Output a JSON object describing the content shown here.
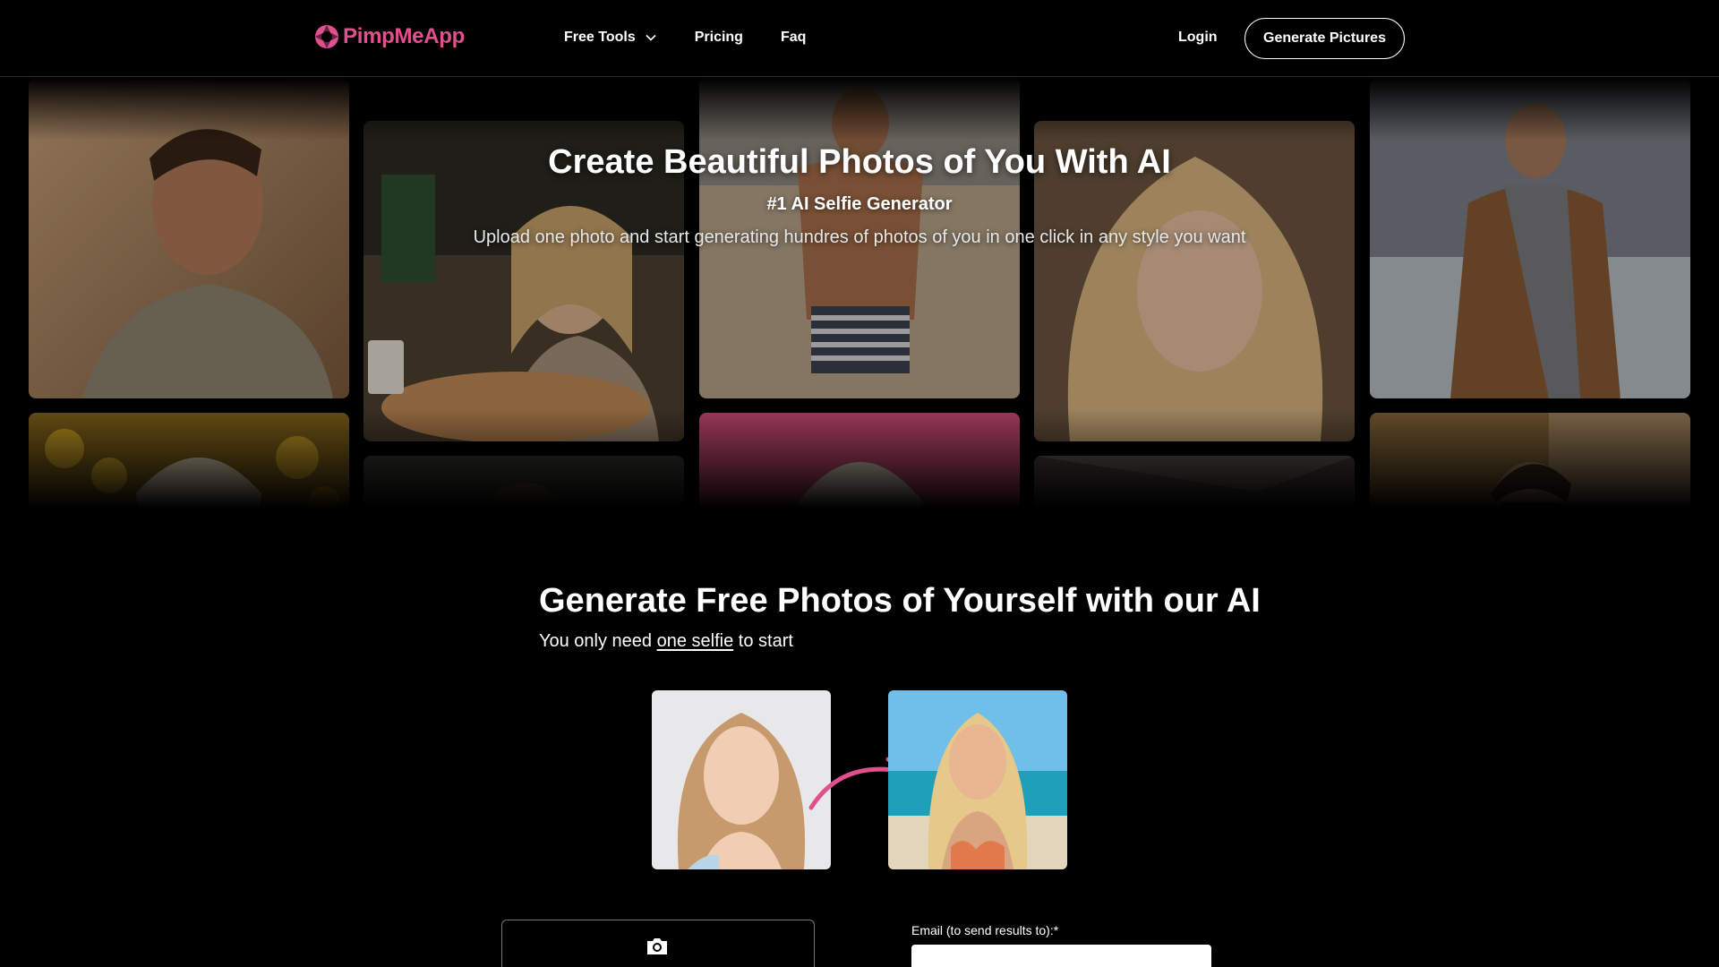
{
  "header": {
    "logo_text": "PimpMeApp",
    "brand_color": "#e0508f",
    "nav": [
      {
        "label": "Free Tools",
        "has_dropdown": true
      },
      {
        "label": "Pricing"
      },
      {
        "label": "Faq"
      }
    ],
    "login_label": "Login",
    "cta_label": "Generate Pictures"
  },
  "hero": {
    "title": "Create Beautiful Photos of You With AI",
    "subtitle": "#1 AI Selfie Generator",
    "description": "Upload one photo and start generating hundres of photos of you in one click in any style you want"
  },
  "section": {
    "title": "Generate Free Photos of Yourself with our AI",
    "sub_before": "You only need ",
    "sub_link": "one selfie",
    "sub_after": " to start"
  },
  "form": {
    "upload_icon": "camera-icon",
    "email_label": "Email (to send results to):*",
    "email_value": ""
  }
}
